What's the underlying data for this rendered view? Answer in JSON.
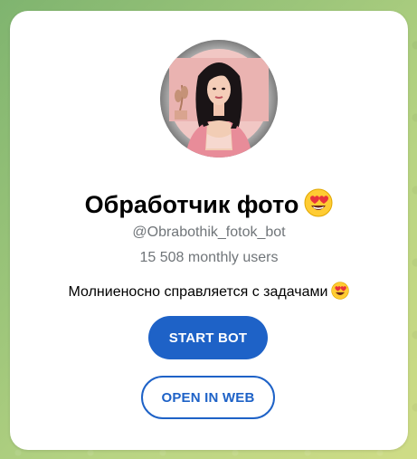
{
  "bot": {
    "title": "Обработчик фото",
    "title_emoji": "heart-eyes-emoji",
    "username": "@Obrabothik_fotok_bot",
    "monthly_users": "15 508 monthly users",
    "description": "Молниеносно справляется с задачами",
    "description_emoji": "heart-eyes-emoji",
    "avatar": "woman-portrait-avatar"
  },
  "actions": {
    "start_label": "START BOT",
    "web_label": "OPEN IN WEB"
  },
  "colors": {
    "accent": "#1e62c7",
    "muted_text": "#707579",
    "background_green": "#9cc57a"
  }
}
